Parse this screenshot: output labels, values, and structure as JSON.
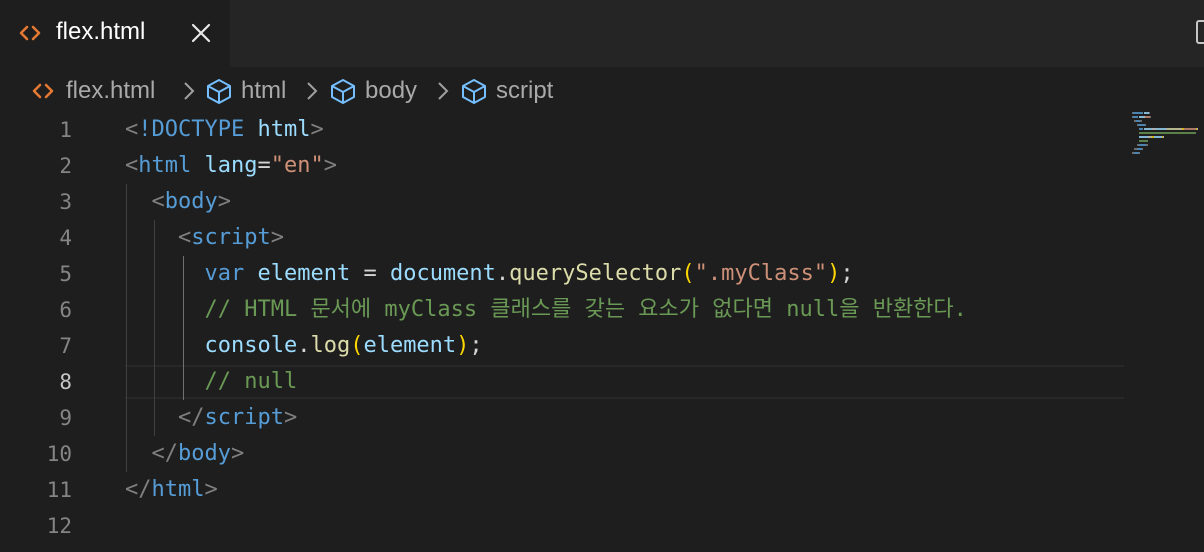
{
  "tab": {
    "label": "flex.html",
    "icon": "html-file-icon",
    "close_icon": "close-icon"
  },
  "breadcrumb": [
    {
      "label": "flex.html",
      "icon": "html-file-icon"
    },
    {
      "label": "html",
      "icon": "cube-icon"
    },
    {
      "label": "body",
      "icon": "cube-icon"
    },
    {
      "label": "script",
      "icon": "cube-icon"
    }
  ],
  "editor": {
    "active_line": 8,
    "line_numbers": [
      "1",
      "2",
      "3",
      "4",
      "5",
      "6",
      "7",
      "8",
      "9",
      "10",
      "11",
      "12"
    ],
    "lines": [
      [
        [
          "t-br",
          "<"
        ],
        [
          "t-tag",
          "!DOCTYPE"
        ],
        [
          "t-op",
          " "
        ],
        [
          "t-attr",
          "html"
        ],
        [
          "t-br",
          ">"
        ]
      ],
      [
        [
          "t-br",
          "<"
        ],
        [
          "t-tag",
          "html"
        ],
        [
          "t-op",
          " "
        ],
        [
          "t-attr",
          "lang"
        ],
        [
          "t-op",
          "="
        ],
        [
          "t-str",
          "\"en\""
        ],
        [
          "t-br",
          ">"
        ]
      ],
      [
        [
          "t-op",
          "  "
        ],
        [
          "t-br",
          "<"
        ],
        [
          "t-tag",
          "body"
        ],
        [
          "t-br",
          ">"
        ]
      ],
      [
        [
          "t-op",
          "    "
        ],
        [
          "t-br",
          "<"
        ],
        [
          "t-tag",
          "script"
        ],
        [
          "t-br",
          ">"
        ]
      ],
      [
        [
          "t-op",
          "      "
        ],
        [
          "t-kw",
          "var"
        ],
        [
          "t-op",
          " "
        ],
        [
          "t-var",
          "element"
        ],
        [
          "t-op",
          " = "
        ],
        [
          "t-var",
          "document"
        ],
        [
          "t-op",
          "."
        ],
        [
          "t-fn",
          "querySelector"
        ],
        [
          "t-paren",
          "("
        ],
        [
          "t-str",
          "\".myClass\""
        ],
        [
          "t-paren",
          ")"
        ],
        [
          "t-op",
          ";"
        ]
      ],
      [
        [
          "t-op",
          "      "
        ],
        [
          "t-cm",
          "// HTML 문서에 myClass 클래스를 갖는 요소가 없다면 null을 반환한다."
        ]
      ],
      [
        [
          "t-op",
          "      "
        ],
        [
          "t-var",
          "console"
        ],
        [
          "t-op",
          "."
        ],
        [
          "t-fn",
          "log"
        ],
        [
          "t-paren",
          "("
        ],
        [
          "t-var",
          "element"
        ],
        [
          "t-paren",
          ")"
        ],
        [
          "t-op",
          ";"
        ]
      ],
      [
        [
          "t-op",
          "      "
        ],
        [
          "t-cm",
          "// null"
        ]
      ],
      [
        [
          "t-op",
          "    "
        ],
        [
          "t-br",
          "</"
        ],
        [
          "t-tag",
          "script"
        ],
        [
          "t-br",
          ">"
        ]
      ],
      [
        [
          "t-op",
          "  "
        ],
        [
          "t-br",
          "</"
        ],
        [
          "t-tag",
          "body"
        ],
        [
          "t-br",
          ">"
        ]
      ],
      [
        [
          "t-br",
          "</"
        ],
        [
          "t-tag",
          "html"
        ],
        [
          "t-br",
          ">"
        ]
      ],
      []
    ]
  },
  "colors": {
    "background": "#1e1e1e",
    "tag": "#569cd6",
    "attribute": "#9cdcfe",
    "string": "#ce9178",
    "function": "#dcdcaa",
    "comment": "#6a9955",
    "bracket": "#ffd700",
    "file_icon": "#e37933"
  }
}
